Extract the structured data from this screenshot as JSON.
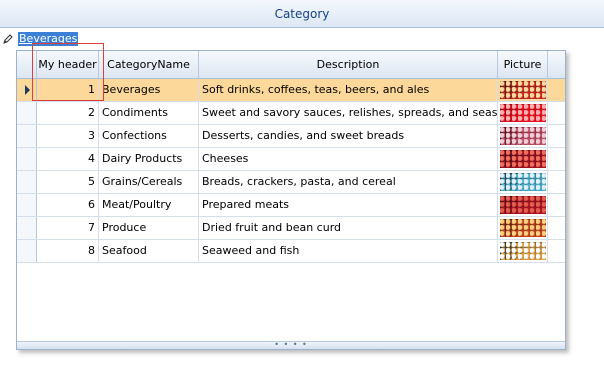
{
  "column_header": {
    "label": "Category"
  },
  "editor": {
    "value": "Beverages"
  },
  "grid": {
    "headers": [
      "My header",
      "CategoryName",
      "Description",
      "Picture"
    ],
    "selected_index": 0,
    "rows": [
      {
        "id": "1",
        "name": "Beverages",
        "description": "Soft drinks, coffees, teas, beers, and ales"
      },
      {
        "id": "2",
        "name": "Condiments",
        "description": "Sweet and savory sauces, relishes, spreads, and seasonings"
      },
      {
        "id": "3",
        "name": "Confections",
        "description": "Desserts, candies, and sweet breads"
      },
      {
        "id": "4",
        "name": "Dairy Products",
        "description": "Cheeses"
      },
      {
        "id": "5",
        "name": "Grains/Cereals",
        "description": "Breads, crackers, pasta, and cereal"
      },
      {
        "id": "6",
        "name": "Meat/Poultry",
        "description": "Prepared meats"
      },
      {
        "id": "7",
        "name": "Produce",
        "description": "Dried fruit and bean curd"
      },
      {
        "id": "8",
        "name": "Seafood",
        "description": "Seaweed and fish"
      }
    ]
  },
  "colors": {
    "selected_row": "#fcd99a",
    "header_text": "#15428b",
    "editor_highlight": "#3b7fd6",
    "annotation_box": "#e03c3c"
  }
}
